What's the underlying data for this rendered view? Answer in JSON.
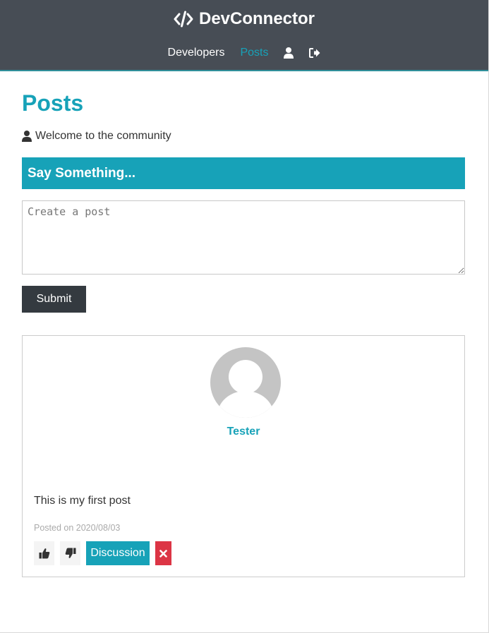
{
  "navbar": {
    "brand_icon": "code-icon",
    "brand": "DevConnector",
    "links": [
      {
        "label": "Developers"
      },
      {
        "label": "Posts",
        "active": true
      }
    ],
    "user_icon": "user-icon",
    "logout_icon": "sign-out-icon"
  },
  "page": {
    "title": "Posts",
    "lead": "Welcome to the community",
    "lead_icon": "user-icon"
  },
  "post_form": {
    "header": "Say Something...",
    "placeholder": "Create a post",
    "value": "",
    "submit_label": "Submit"
  },
  "posts": [
    {
      "author": "Tester",
      "text": "This is my first post",
      "date_prefix": "Posted on",
      "date": "2020/08/03",
      "discussion_label": "Discussion",
      "like_icon": "thumbs-up-icon",
      "unlike_icon": "thumbs-down-icon",
      "delete_icon": "times-icon"
    }
  ],
  "colors": {
    "primary": "#17a2b8",
    "dark": "#343a40",
    "navbar": "#474d55",
    "danger": "#dc3545",
    "light": "#f4f4f4"
  }
}
